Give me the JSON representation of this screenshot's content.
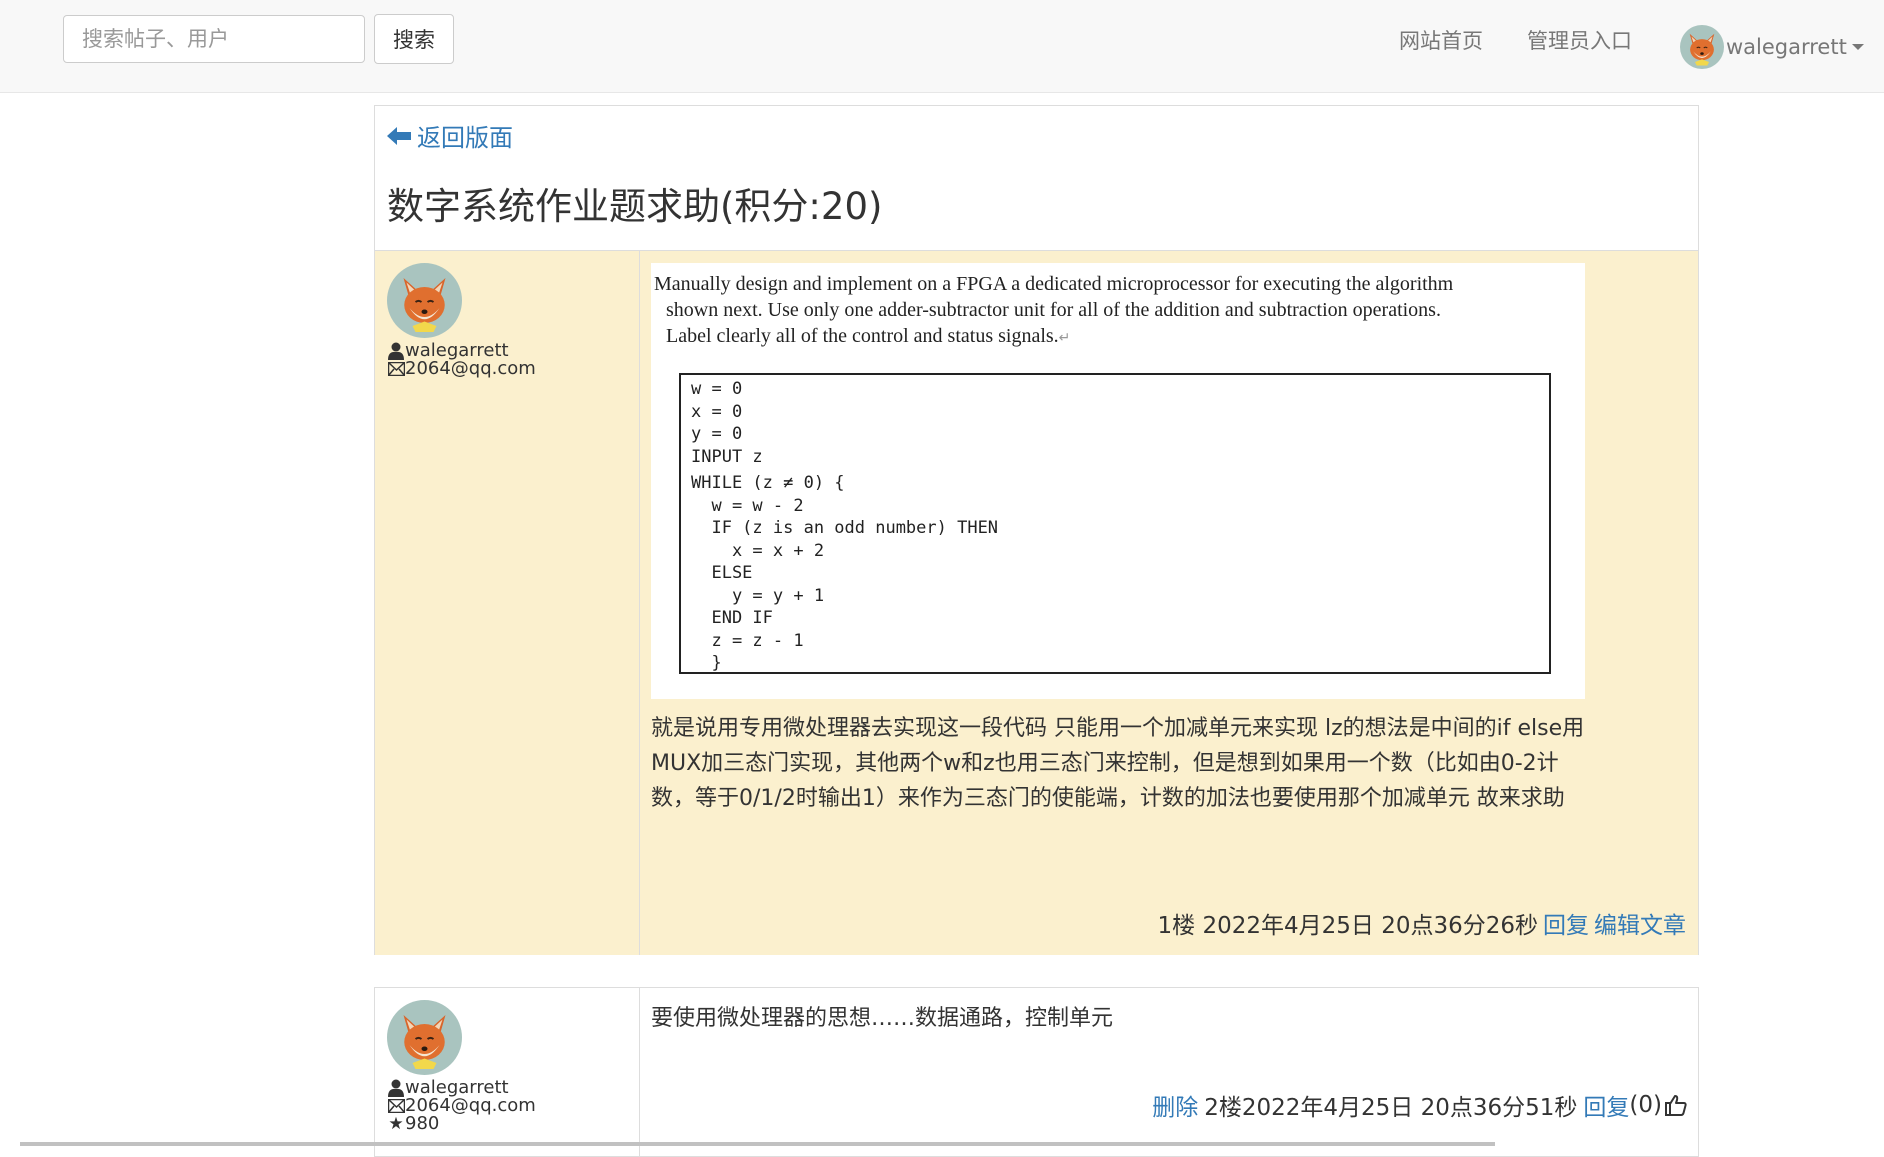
{
  "navbar": {
    "search_placeholder": "搜索帖子、用户",
    "search_button": "搜索",
    "home_link": "网站首页",
    "admin_link": "管理员入口",
    "username": "walegarrett"
  },
  "thread": {
    "back_label": "返回版面",
    "title": "数字系统作业题求助(积分:20)"
  },
  "post1": {
    "author": "walegarrett",
    "email": "2064@qq.com",
    "image_text": {
      "line1": "Manually design and implement on a FPGA a dedicated microprocessor for executing the algorithm",
      "line2": "shown next. Use only one adder-subtractor unit for all of the addition and subtraction operations.",
      "line3": "Label clearly all of the control and status signals."
    },
    "code": [
      "w = 0",
      "x = 0",
      "y = 0",
      "INPUT z",
      "WHILE (z ≠ 0) {",
      "  w = w - 2",
      "  IF (z is an odd number) THEN",
      "    x = x + 2",
      "  ELSE",
      "    y = y + 1",
      "  END IF",
      "  z = z - 1",
      "  }"
    ],
    "body": "就是说用专用微处理器去实现这一段代码 只能用一个加减单元来实现 lz的想法是中间的if else用MUX加三态门实现，其他两个w和z也用三态门来控制，但是想到如果用一个数（比如由0-2计数，等于0/1/2时输出1）来作为三态门的使能端，计数的加法也要使用那个加减单元 故来求助",
    "footer_meta": "1楼 2022年4月25日 20点36分26秒",
    "reply_label": "回复",
    "edit_label": "编辑文章"
  },
  "post2": {
    "author": "walegarrett",
    "email": "2064@qq.com",
    "score": "980",
    "body": "要使用微处理器的思想……数据通路，控制单元",
    "delete_label": "删除",
    "footer_meta": "2楼2022年4月25日 20点36分51秒",
    "reply_label": "回复",
    "like_count": "(0)"
  }
}
